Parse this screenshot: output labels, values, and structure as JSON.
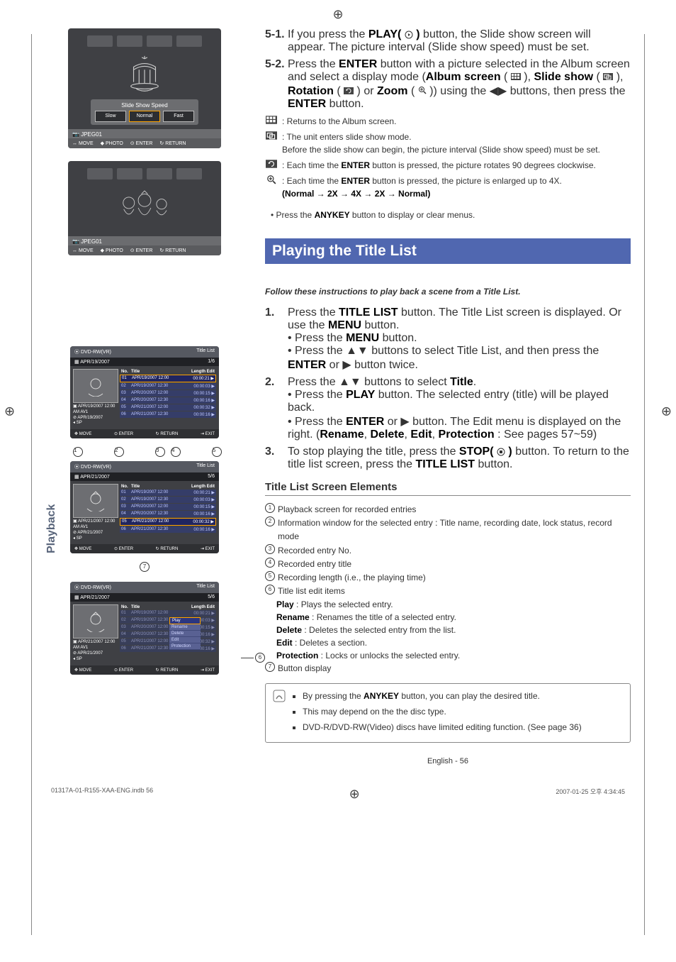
{
  "crop_glyph": "⊕",
  "side_tab": "Playback",
  "slideshow_panel": {
    "speed_label": "Slide Show Speed",
    "slow": "Slow",
    "normal": "Normal",
    "fast": "Fast",
    "jpeg": "JPEG01",
    "ctrl_move": "MOVE",
    "ctrl_photo": "PHOTO",
    "ctrl_enter": "ENTER",
    "ctrl_return": "RETURN"
  },
  "steps51": {
    "label51": "5-1.",
    "text51": "If you press the PLAY(      ) button, the Slide show screen will appear. The picture interval (Slide show speed) must be set.",
    "label52": "5-2.",
    "text52": "Press the ENTER button with a picture selected in the Album screen and select a display mode (Album screen (    ), Slide show (    ), Rotation (    ) or Zoom (    )) using the ◀▶ buttons, then press the ENTER button."
  },
  "icon_lines": {
    "a": ": Returns to the Album screen.",
    "b1": ": The unit enters slide show mode.",
    "b2": "Before the slide show can begin, the picture interval (Slide show speed) must be set.",
    "c": ": Each time the ENTER button is pressed, the picture rotates 90 degrees clockwise.",
    "d1": ": Each time the ENTER button is pressed, the picture is enlarged up to 4X.",
    "d2": "(Normal → 2X → 4X → 2X → Normal)"
  },
  "anykey_line": "• Press the ANYKEY button to display or clear menus.",
  "section_title": "Playing the Title List",
  "follow_line": "Follow these instructions to play back a scene from a Title List.",
  "playsteps": {
    "s1_label": "1.",
    "s1": "Press the TITLE LIST button. The Title List screen is displayed. Or use the MENU button.",
    "s1a": "• Press the MENU button.",
    "s1b": "• Press the ▲▼ buttons to select Title List, and then press the ENTER or ▶ button twice.",
    "s2_label": "2.",
    "s2": "Press the ▲▼ buttons to select Title.",
    "s2a": "• Press the PLAY button. The selected entry (title) will be played back.",
    "s2b": "• Press the ENTER or ▶ button. The Edit menu is displayed on the right. (Rename, Delete, Edit, Protection : See pages 57~59)",
    "s3_label": "3.",
    "s3": "To stop playing the title, press the STOP(      ) button. To return to the title list screen, press the TITLE LIST button."
  },
  "sub_heading": "Title List Screen Elements",
  "elements": {
    "e1": "Playback screen for recorded entries",
    "e2": "Information window for the selected entry : Title name, recording date, lock status, record mode",
    "e3": "Recorded entry No.",
    "e4": "Recorded entry title",
    "e5": "Recording length (i.e., the playing time)",
    "e6": "Title list edit items",
    "e6_play": "Play : Plays the selected entry.",
    "e6_rename": "Rename : Renames the title of a selected entry.",
    "e6_delete": "Delete : Deletes the selected entry from the list.",
    "e6_edit": "Edit : Deletes a section.",
    "e6_prot": "Protection : Locks or unlocks the selected entry.",
    "e7": "Button display"
  },
  "note": {
    "n1": "By pressing the ANYKEY button, you can play the desired title.",
    "n2": "This may depend on the the disc type.",
    "n3": "DVD-R/DVD-RW(Video) discs have limited editing function. (See page 36)"
  },
  "title_panel": {
    "head_left": "DVD-RW(VR)",
    "head_right": "Title List",
    "sub_left1": "APR/19/2007",
    "sub_right1": "1/6",
    "sub_left2": "APR/21/2007",
    "sub_right2": "5/6",
    "th_no": "No.",
    "th_title": "Title",
    "th_len": "Length Edit",
    "meta1a": "APR/19/2007 12:00 AM AV1",
    "meta1b": "APR/19/2007",
    "meta1c": "SP",
    "meta2a": "APR/21/2007 12:00 AM AV1",
    "meta2b": "APR/21/2007",
    "meta2c": "SP",
    "rows": [
      {
        "no": "01",
        "title": "APR/19/2007 12:00",
        "len": "00:00:21 ▶"
      },
      {
        "no": "02",
        "title": "APR/19/2007 12:30",
        "len": "00:00:03 ▶"
      },
      {
        "no": "03",
        "title": "APR/20/2007 12:00",
        "len": "00:00:15 ▶"
      },
      {
        "no": "04",
        "title": "APR/20/2007 12:30",
        "len": "00:00:16 ▶"
      },
      {
        "no": "05",
        "title": "APR/21/2007 12:00",
        "len": "00:00:32 ▶"
      },
      {
        "no": "06",
        "title": "APR/21/2007 12:30",
        "len": "00:00:16 ▶"
      }
    ],
    "ctrl_move": "MOVE",
    "ctrl_enter": "ENTER",
    "ctrl_return": "RETURN",
    "ctrl_exit": "EXIT",
    "popup": [
      "Play",
      "Rename",
      "Delete",
      "Edit",
      "Protection"
    ]
  },
  "page_footer": "English - 56",
  "print_left": "01317A-01-R155-XAA-ENG.indb   56",
  "print_right": "2007-01-25   오후 4:34:45"
}
